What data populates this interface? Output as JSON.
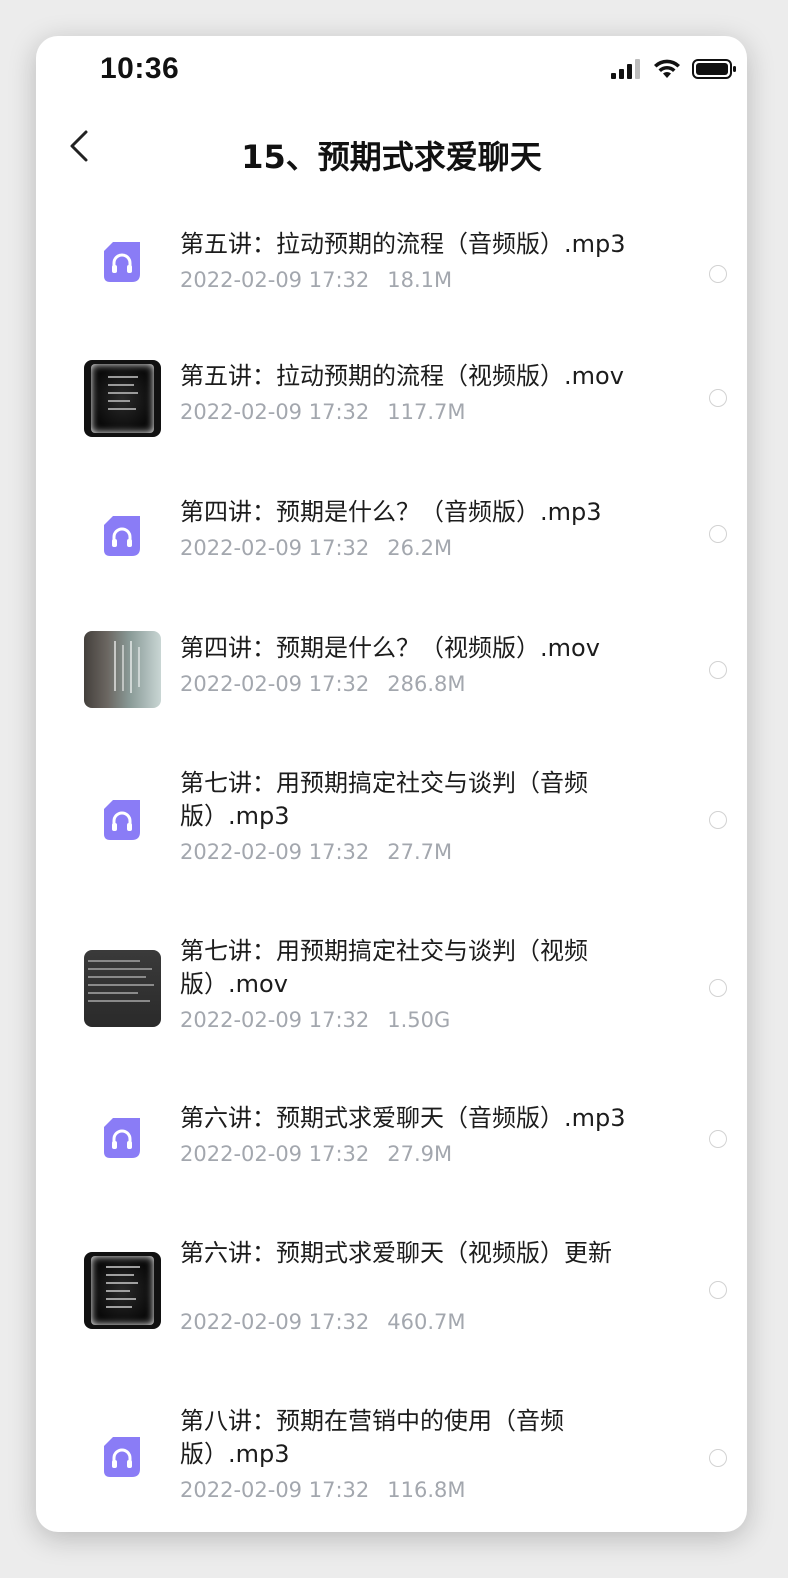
{
  "status_bar": {
    "time": "10:36"
  },
  "header": {
    "title": "15、预期式求爱聊天"
  },
  "files": [
    {
      "name": "第五讲：拉动预期的流程（音频版）.mp3",
      "date": "2022-02-09 17:32",
      "size": "18.1M",
      "type": "audio",
      "icon": "headphones-icon"
    },
    {
      "name": "第五讲：拉动预期的流程（视频版）.mov",
      "date": "2022-02-09 17:32",
      "size": "117.7M",
      "type": "video",
      "icon": "video-thumbnail"
    },
    {
      "name": "第四讲：预期是什么？（音频版）.mp3",
      "date": "2022-02-09 17:32",
      "size": "26.2M",
      "type": "audio",
      "icon": "headphones-icon"
    },
    {
      "name": "第四讲：预期是什么？（视频版）.mov",
      "date": "2022-02-09 17:32",
      "size": "286.8M",
      "type": "video",
      "icon": "video-thumbnail"
    },
    {
      "name": "第七讲：用预期搞定社交与谈判（音频版）.mp3",
      "date": "2022-02-09 17:32",
      "size": "27.7M",
      "type": "audio",
      "icon": "headphones-icon"
    },
    {
      "name": "第七讲：用预期搞定社交与谈判（视频版）.mov",
      "date": "2022-02-09 17:32",
      "size": "1.50G",
      "type": "video",
      "icon": "video-thumbnail"
    },
    {
      "name": "第六讲：预期式求爱聊天（音频版）.mp3",
      "date": "2022-02-09 17:32",
      "size": "27.9M",
      "type": "audio",
      "icon": "headphones-icon"
    },
    {
      "name": "第六讲：预期式求爱聊天（视频版）更新",
      "date": "2022-02-09 17:32",
      "size": "460.7M",
      "type": "video",
      "icon": "video-thumbnail"
    },
    {
      "name": "第八讲：预期在营销中的使用（音频版）.mp3",
      "date": "2022-02-09 17:32",
      "size": "116.8M",
      "type": "audio",
      "icon": "headphones-icon"
    }
  ],
  "colors": {
    "audio_icon": "#8a7cf6",
    "meta_text": "#a3a7ae",
    "radio_border": "#d2d2d2"
  }
}
